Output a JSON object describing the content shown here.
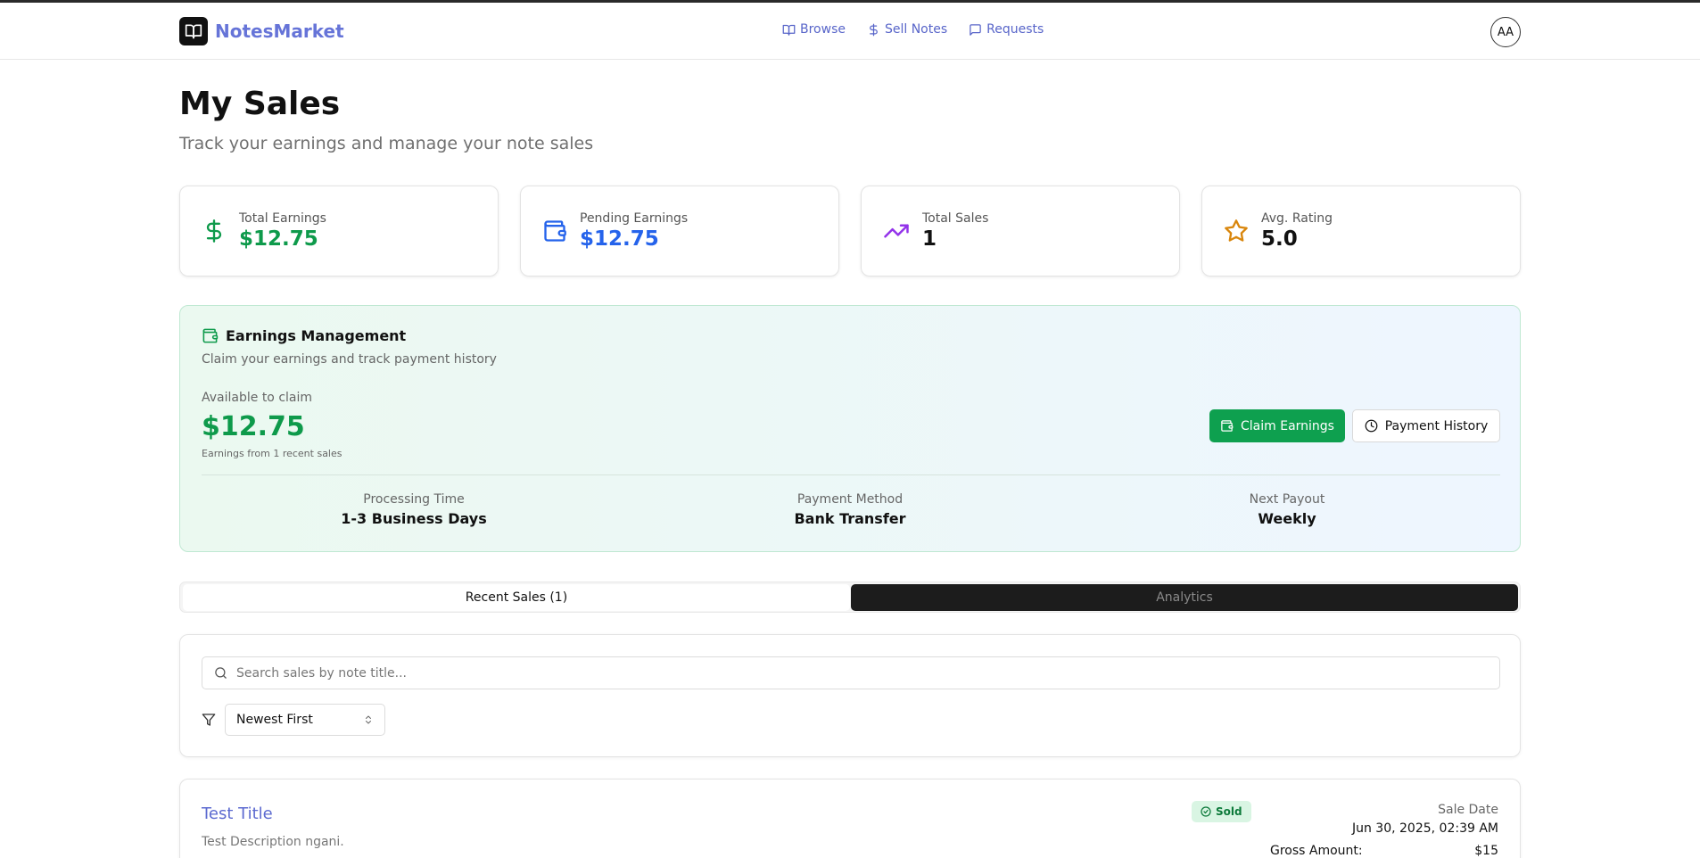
{
  "app": {
    "name": "NotesMarket"
  },
  "nav": [
    {
      "label": "Browse"
    },
    {
      "label": "Sell Notes"
    },
    {
      "label": "Requests"
    }
  ],
  "user": {
    "initials": "AA"
  },
  "page": {
    "title": "My Sales",
    "subtitle": "Track your earnings and manage your note sales"
  },
  "stats": [
    {
      "label": "Total Earnings",
      "value": "$12.75",
      "icon": "dollar-icon",
      "color": "#0e9a4b"
    },
    {
      "label": "Pending Earnings",
      "value": "$12.75",
      "icon": "wallet-icon",
      "color": "#2563eb"
    },
    {
      "label": "Total Sales",
      "value": "1",
      "icon": "trending-up-icon",
      "color": "#111111"
    },
    {
      "label": "Avg. Rating",
      "value": "5.0",
      "icon": "star-icon",
      "color": "#111111"
    }
  ],
  "earnings": {
    "title": "Earnings Management",
    "subtitle": "Claim your earnings and track payment history",
    "available_label": "Available to claim",
    "available_value": "$12.75",
    "available_note": "Earnings from 1 recent sales",
    "claim_label": "Claim Earnings",
    "history_label": "Payment History",
    "info": [
      {
        "label": "Processing Time",
        "value": "1-3 Business Days"
      },
      {
        "label": "Payment Method",
        "value": "Bank Transfer"
      },
      {
        "label": "Next Payout",
        "value": "Weekly"
      }
    ]
  },
  "tabs": [
    {
      "label": "Recent Sales (1)"
    },
    {
      "label": "Analytics"
    }
  ],
  "filters": {
    "search_placeholder": "Search sales by note title...",
    "sort_value": "Newest First"
  },
  "sale": {
    "title": "Test Title",
    "description": "Test Description ngani.",
    "status": "Sold",
    "date_label": "Sale Date",
    "date": "Jun 30, 2025, 02:39 AM",
    "gross_label": "Gross Amount:",
    "gross_value": "$15"
  },
  "colors": {
    "brand": "#6674d8",
    "nav_link": "#5865c9",
    "claim_button": "#0ea04f",
    "green": "#0e9a4b",
    "blue": "#2563eb",
    "purple": "#9333ea",
    "amber": "#d9860c"
  }
}
